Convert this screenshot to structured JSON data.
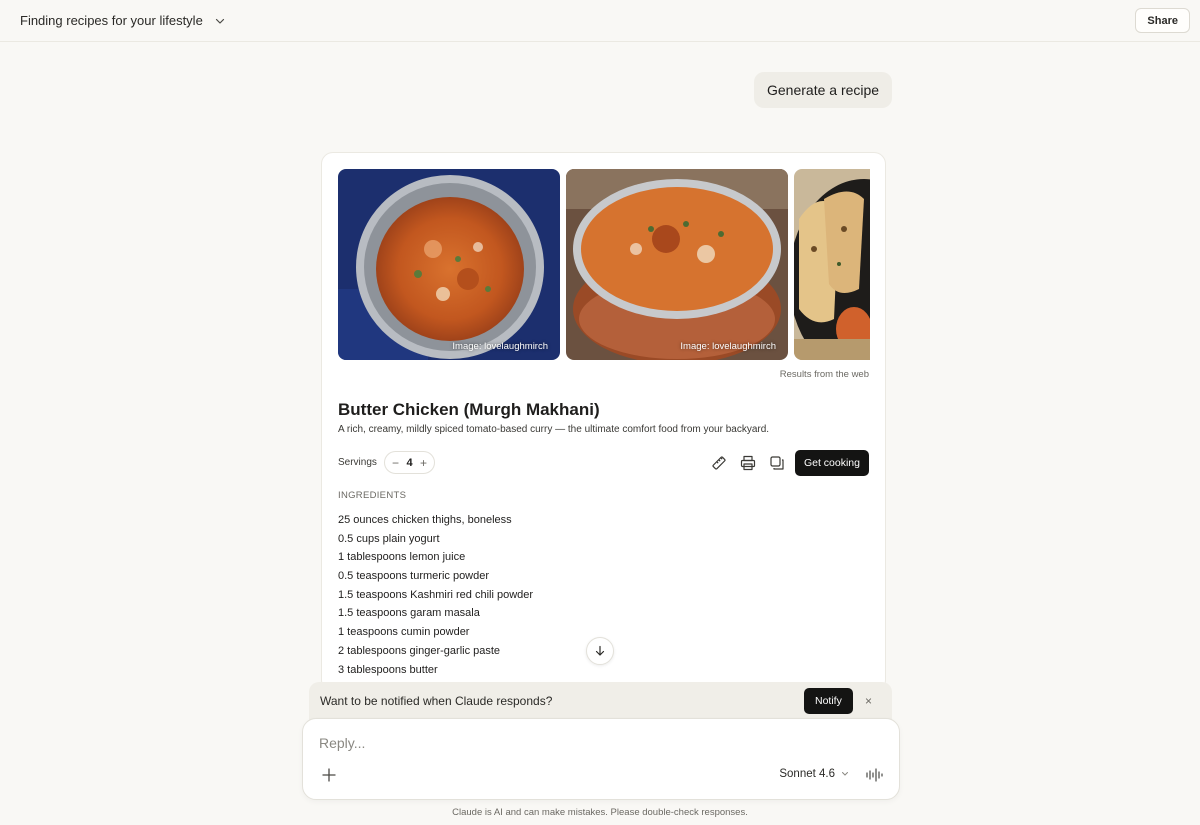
{
  "header": {
    "conversation_title": "Finding recipes for your lifestyle",
    "share_label": "Share"
  },
  "user_message": "Generate a recipe",
  "recipe": {
    "images": [
      {
        "credit": "Image: lovelaughmirch"
      },
      {
        "credit": "Image: lovelaughmirch"
      },
      {
        "credit": ""
      }
    ],
    "results_source": "Results from the web",
    "title": "Butter Chicken (Murgh Makhani)",
    "description": "A rich, creamy, mildly spiced tomato-based curry — the ultimate comfort food from your backyard.",
    "servings_label": "Servings",
    "servings_value": "4",
    "decrement": "−",
    "increment": "+",
    "get_cooking_label": "Get cooking",
    "ingredients_header": "INGREDIENTS",
    "ingredients": [
      "25 ounces chicken thighs, boneless",
      "0.5 cups plain yogurt",
      "1 tablespoons lemon juice",
      "0.5 teaspoons turmeric powder",
      "1.5 teaspoons Kashmiri red chili powder",
      "1.5 teaspoons garam masala",
      "1 teaspoons cumin powder",
      "2 tablespoons ginger-garlic paste",
      "3 tablespoons butter"
    ],
    "tool_icons": [
      "ruler-icon",
      "print-icon",
      "copy-icon"
    ]
  },
  "notify": {
    "text": "Want to be notified when Claude responds?",
    "button_label": "Notify",
    "close": "×"
  },
  "composer": {
    "placeholder": "Reply...",
    "model": "Sonnet 4.6"
  },
  "disclaimer": "Claude is AI and can make mistakes. Please double-check responses.",
  "colors": {
    "background": "#f9f8f5",
    "primary_button": "#141413",
    "user_bubble": "#efede7"
  }
}
